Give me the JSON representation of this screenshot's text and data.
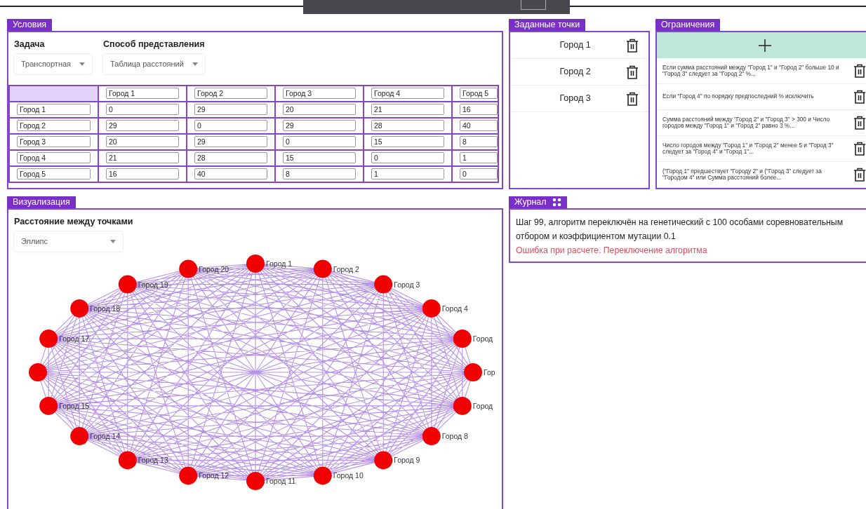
{
  "conditions": {
    "title": "Условия",
    "task": {
      "label": "Задача",
      "value": "Транспортная"
    },
    "representation": {
      "label": "Способ представления",
      "value": "Таблица расстояний"
    },
    "table": {
      "columns": [
        "Город 1",
        "Город 2",
        "Город 3",
        "Город 4",
        "Город 5"
      ],
      "rows": [
        {
          "name": "Город 1",
          "cells": [
            "0",
            "29",
            "20",
            "21",
            "16"
          ]
        },
        {
          "name": "Город 2",
          "cells": [
            "29",
            "0",
            "29",
            "28",
            "40"
          ]
        },
        {
          "name": "Город 3",
          "cells": [
            "20",
            "29",
            "0",
            "15",
            "8"
          ]
        },
        {
          "name": "Город 4",
          "cells": [
            "21",
            "28",
            "15",
            "0",
            "1"
          ]
        },
        {
          "name": "Город 5",
          "cells": [
            "16",
            "40",
            "8",
            "1",
            "0"
          ]
        }
      ]
    }
  },
  "points": {
    "title": "Заданные точки",
    "items": [
      "Город 1",
      "Город 2",
      "Город 3"
    ]
  },
  "constraints": {
    "title": "Ограничения",
    "items": [
      "Если сумма расстояний между \"Город 1\" и \"Город 2\" больше 10 и \"Город 3\" следует за \"Город 2\" %...",
      "Если \"Город 4\" по порядку предпоследний % исключить",
      "Сумма расстояний между \"Город 2\" и \"Город 3\" > 300 и Число городов между \"Город 1\" и \"Город 2\" равно 3 %...",
      "Число городов между \"Город 1\" и \"Город 2\" менее 5 и \"Город 3\" следует за \"Город 4\" и \"Город 1\"...",
      "(\"Город 1\" предшествует \"Городу 2\" и (\"Город 3\" следует за \"Городом 4\" или Сумма расстояний более..."
    ]
  },
  "visualization": {
    "title": "Визуализация",
    "label": "Расстояние между точками",
    "layout": "Эллипс",
    "nodes": [
      {
        "kind": "labeled",
        "label": "Город 1"
      },
      {
        "kind": "labeled",
        "label": "Город 2"
      },
      {
        "kind": "labeled",
        "label": "Город 3"
      },
      {
        "kind": "labeled",
        "label": "Город 4"
      },
      {
        "kind": "labeled",
        "label": "Город"
      },
      {
        "kind": "labeled",
        "label": "Гор"
      },
      {
        "kind": "labeled",
        "label": "Город"
      },
      {
        "kind": "labeled",
        "label": "Город 8"
      },
      {
        "kind": "labeled",
        "label": "Город 9"
      },
      {
        "kind": "labeled",
        "label": "Город 10"
      },
      {
        "kind": "labeled",
        "label": "Город 11"
      },
      {
        "kind": "labeled",
        "label": "Город 12"
      },
      {
        "kind": "labeled",
        "label": "Город 13"
      },
      {
        "kind": "labeled",
        "label": "Город 14"
      },
      {
        "kind": "labeled",
        "label": "Город 15"
      },
      {
        "kind": "unlabeled"
      },
      {
        "kind": "labeled",
        "label": "Город 17"
      },
      {
        "kind": "labeled",
        "label": "Город 18"
      },
      {
        "kind": "labeled",
        "label": "Город 19"
      },
      {
        "kind": "labeled",
        "label": "Город 20"
      }
    ]
  },
  "journal": {
    "title": "Журнал",
    "messages": [
      {
        "kind": "info",
        "text": "Шаг 99, алгоритм переключён на генетический с 100 особами соревновательным отбором и коэффициентом мутации 0.1"
      },
      {
        "kind": "error",
        "text": "Ошибка при расчете. Переключение алгоритма"
      }
    ]
  }
}
